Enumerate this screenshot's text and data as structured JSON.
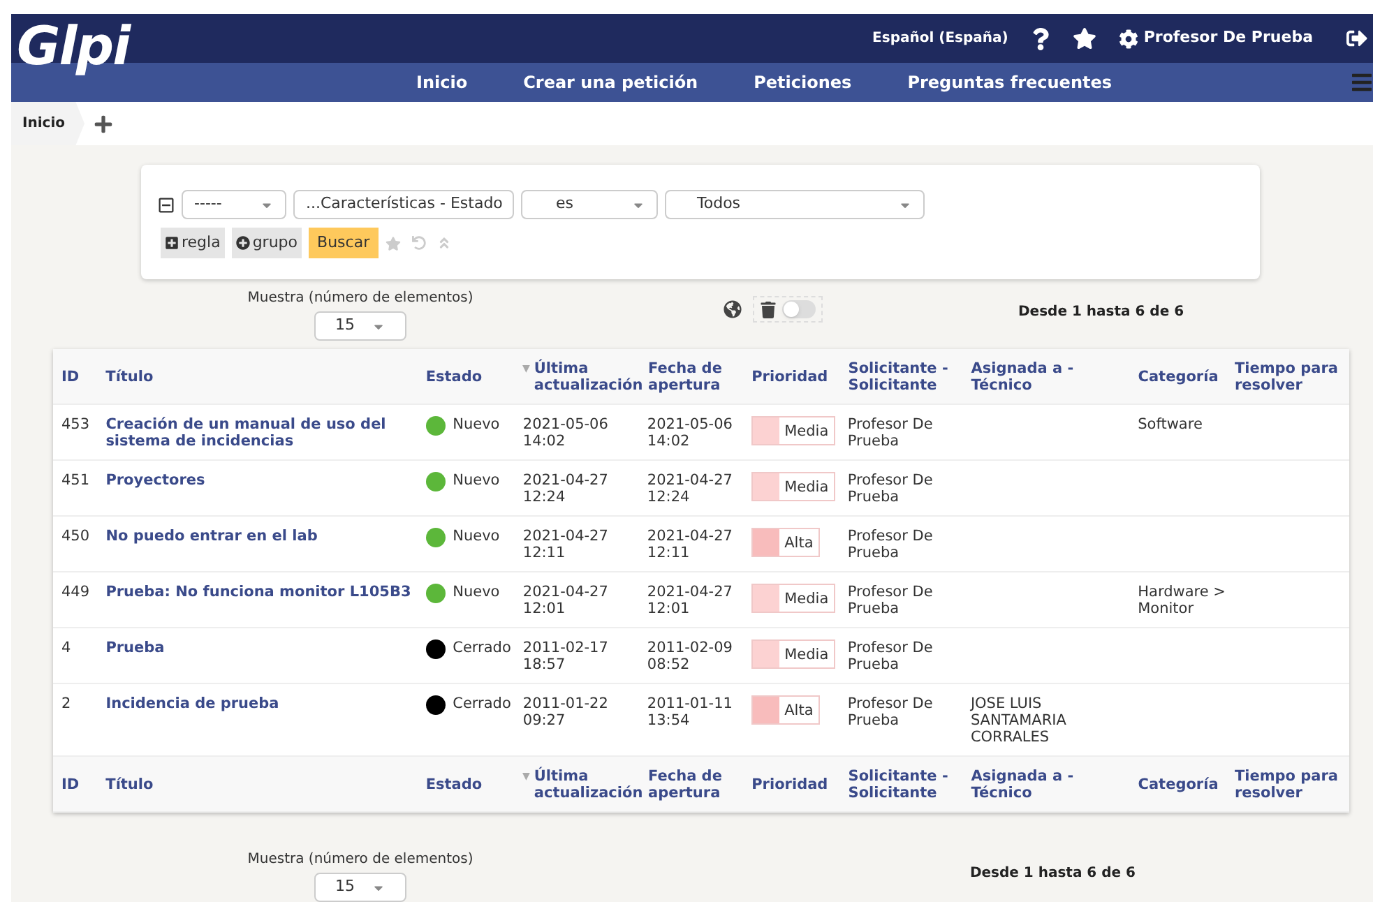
{
  "header": {
    "logo": "Glpi",
    "language": "Español (España)",
    "user": "Profesor De Prueba"
  },
  "nav": [
    {
      "label": "Inicio",
      "selected": false
    },
    {
      "label": "Crear una petición",
      "selected": false
    },
    {
      "label": "Peticiones",
      "selected": false
    },
    {
      "label": "Preguntas frecuentes",
      "selected": false
    }
  ],
  "breadcrumb": "Inicio",
  "search": {
    "link": "-----",
    "field": "...Características - Estado",
    "operator": "es",
    "value": "Todos",
    "buttons": [
      "regla",
      "grupo"
    ],
    "submit": "Buscar"
  },
  "pager_top": {
    "label": "Muestra (número de elementos)",
    "value": "15",
    "range": "Desde 1 hasta 6 de 6",
    "trash_toggle": false
  },
  "table": {
    "columns": [
      {
        "label": "ID"
      },
      {
        "label": "Título"
      },
      {
        "label": "Estado"
      },
      {
        "label": "Última actualización",
        "sort_mark": "▼"
      },
      {
        "label": "Fecha de apertura"
      },
      {
        "label": "Prioridad"
      },
      {
        "label": "Solicitante - Solicitante"
      },
      {
        "label": "Asignada a - Técnico"
      },
      {
        "label": "Categoría"
      },
      {
        "label": "Tiempo para resolver"
      }
    ],
    "rows": [
      {
        "id": "453",
        "title": "Creación de un manual de uso del sistema de incidencias",
        "status": {
          "label": "Nuevo",
          "color": "#5cb73a"
        },
        "updated": "2021-05-06 14:02",
        "opened": "2021-05-06 14:02",
        "priority": {
          "label": "Media",
          "color": "#fcd2d2"
        },
        "requester": "Profesor De Prueba",
        "category": "Software"
      },
      {
        "id": "451",
        "title": "Proyectores",
        "status": {
          "label": "Nuevo",
          "color": "#5cb73a"
        },
        "updated": "2021-04-27 12:24",
        "opened": "2021-04-27 12:24",
        "priority": {
          "label": "Media",
          "color": "#fcd2d2"
        },
        "requester": "Profesor De Prueba"
      },
      {
        "id": "450",
        "title": "No puedo entrar en el lab",
        "status": {
          "label": "Nuevo",
          "color": "#5cb73a"
        },
        "updated": "2021-04-27 12:11",
        "opened": "2021-04-27 12:11",
        "priority": {
          "label": "Alta",
          "color": "#f8bcbc"
        },
        "requester": "Profesor De Prueba"
      },
      {
        "id": "449",
        "title": "Prueba: No funciona monitor L105B3",
        "status": {
          "label": "Nuevo",
          "color": "#5cb73a"
        },
        "updated": "2021-04-27 12:01",
        "opened": "2021-04-27 12:01",
        "priority": {
          "label": "Media",
          "color": "#fcd2d2"
        },
        "requester": "Profesor De Prueba",
        "category": "Hardware > Monitor"
      },
      {
        "id": "4",
        "title": "Prueba",
        "status": {
          "label": "Cerrado",
          "color": "#000000"
        },
        "updated": "2011-02-17 18:57",
        "opened": "2011-02-09 08:52",
        "priority": {
          "label": "Media",
          "color": "#fcd2d2"
        },
        "requester": "Profesor De Prueba"
      },
      {
        "id": "2",
        "title": "Incidencia de prueba",
        "status": {
          "label": "Cerrado",
          "color": "#000000"
        },
        "updated": "2011-01-22 09:27",
        "opened": "2011-01-11 13:54",
        "priority": {
          "label": "Alta",
          "color": "#f8bcbc"
        },
        "requester": "Profesor De Prueba",
        "assigned": "JOSE LUIS SANTAMARIA CORRALES"
      }
    ],
    "footer_columns": [
      {
        "label": "ID"
      },
      {
        "label": "Título"
      },
      {
        "label": "Estado"
      },
      {
        "label": "Última actualización",
        "sort_mark": "▼"
      },
      {
        "label": "Fecha de apertura"
      },
      {
        "label": "Prioridad"
      },
      {
        "label": "Solicitante - Solicitante"
      },
      {
        "label": "Asignada a - Técnico"
      },
      {
        "label": "Categoría"
      },
      {
        "label": "Tiempo para resolver"
      }
    ]
  },
  "pager_bottom": {
    "label": "Muestra (número de elementos)",
    "value": "15",
    "range": "Desde 1 hasta 6 de 6"
  }
}
